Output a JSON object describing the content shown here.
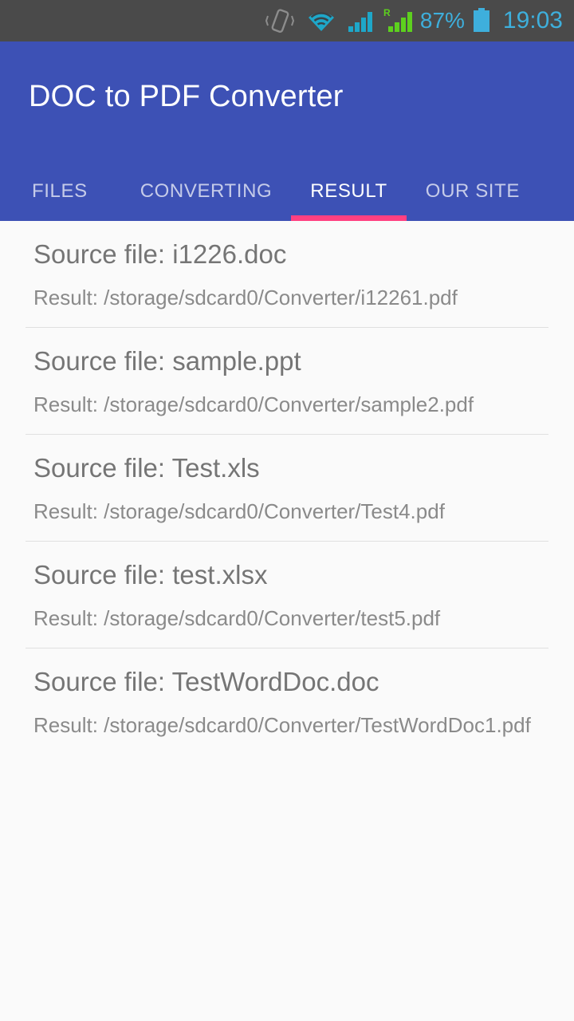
{
  "status_bar": {
    "icons": [
      "vibrate-icon",
      "wifi-icon",
      "signal-icon-sim1",
      "signal-icon-sim2-roaming"
    ],
    "roaming_label": "R",
    "battery_percent": "87%",
    "battery_icon": "battery-full-icon",
    "time": "19:03",
    "text_color": "#3EAFDC",
    "background": "#4A4A4A"
  },
  "appbar": {
    "title": "DOC to PDF Converter",
    "background": "#3D51B5",
    "title_color": "#FFFFFF",
    "indicator_color": "#FF4081"
  },
  "tabs": [
    {
      "label": "FILES",
      "active": false
    },
    {
      "label": "CONVERTING",
      "active": false
    },
    {
      "label": "RESULT",
      "active": true
    },
    {
      "label": "OUR SITE",
      "active": false
    }
  ],
  "results": {
    "items": [
      {
        "source": "Source file: i1226.doc",
        "result": "Result: /storage/sdcard0/Converter/i12261.pdf"
      },
      {
        "source": "Source file: sample.ppt",
        "result": "Result: /storage/sdcard0/Converter/sample2.pdf"
      },
      {
        "source": "Source file: Test.xls",
        "result": "Result: /storage/sdcard0/Converter/Test4.pdf"
      },
      {
        "source": "Source file: test.xlsx",
        "result": "Result: /storage/sdcard0/Converter/test5.pdf"
      },
      {
        "source": "Source file: TestWordDoc.doc",
        "result": "Result: /storage/sdcard0/Converter/TestWordDoc1.pdf"
      }
    ]
  }
}
